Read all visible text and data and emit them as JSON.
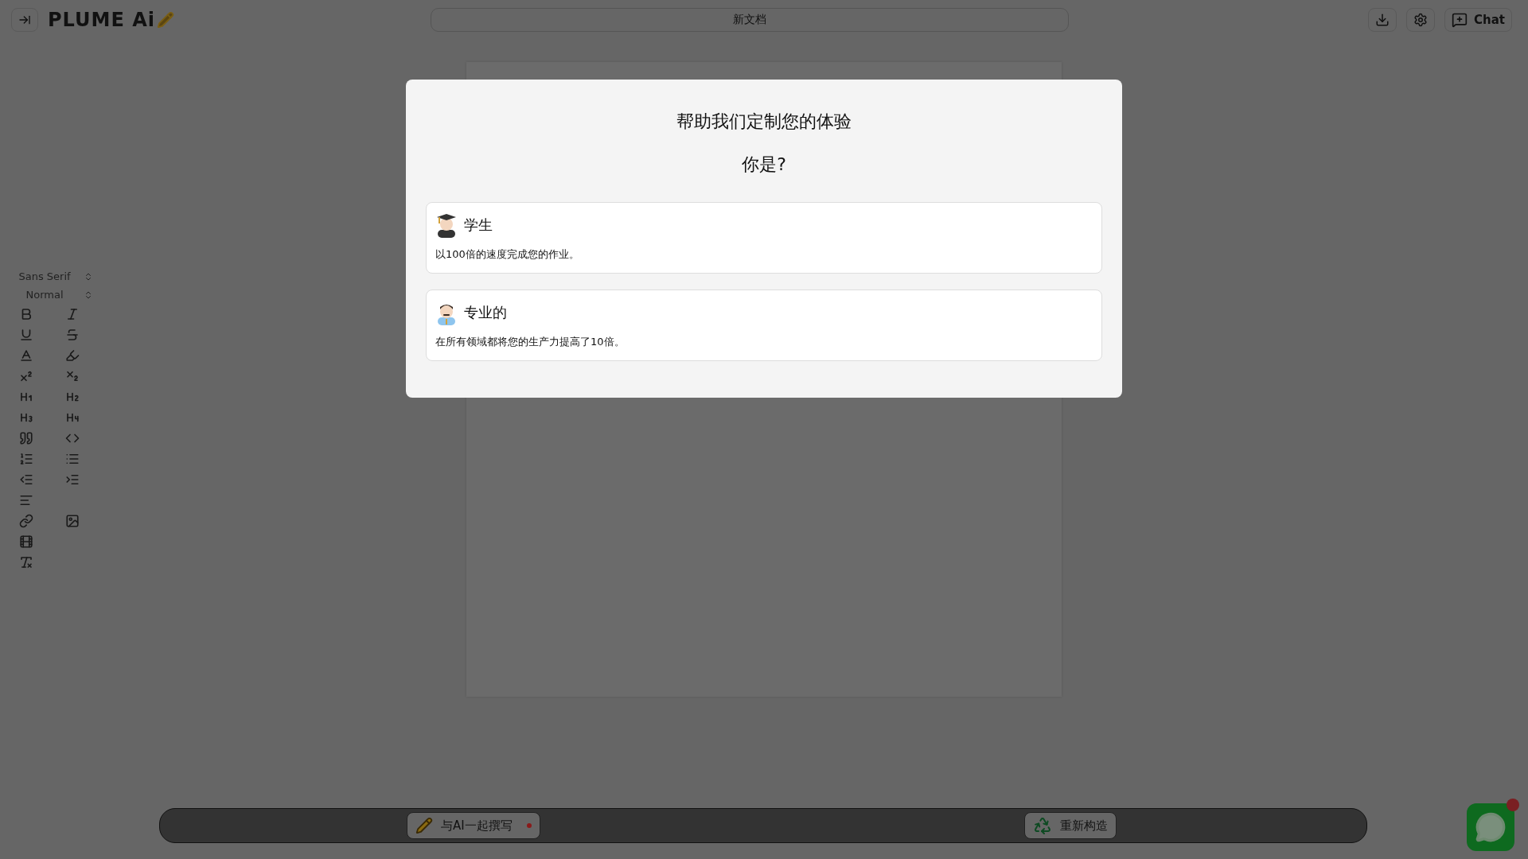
{
  "header": {
    "logo": "PLUME Ai",
    "document_title": "新文档",
    "chat_button": "Chat"
  },
  "editor_toolbar": {
    "font": "Sans Serif",
    "size": "Normal"
  },
  "dialog": {
    "title": "帮助我们定制您的体验",
    "question": "你是?",
    "options": [
      {
        "kind": "student",
        "title": "学生",
        "description": "以100倍的速度完成您的作业。"
      },
      {
        "kind": "professional",
        "title": "专业的",
        "description": "在所有领域都将您的生产力提高了10倍。"
      }
    ]
  },
  "bottom_bar": {
    "write_button": "与AI一起撰写",
    "rebuild_button": "重新构造"
  }
}
